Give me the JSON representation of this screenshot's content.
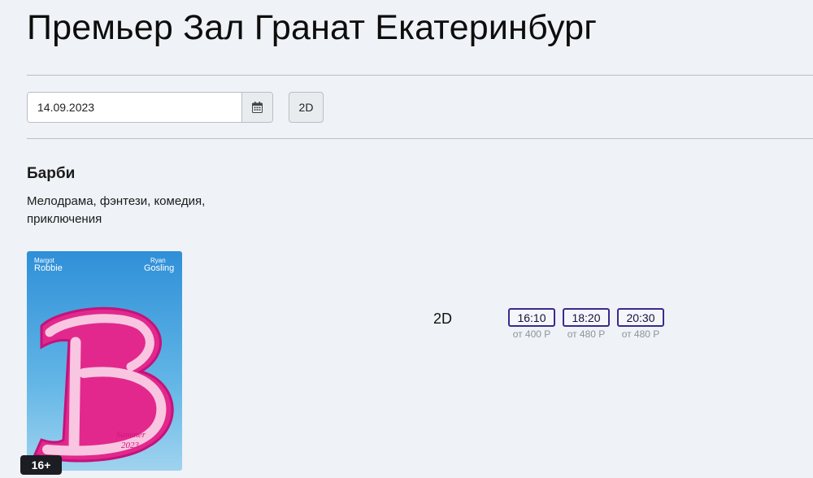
{
  "cinema": {
    "title": "Премьер Зал Гранат Екатеринбург"
  },
  "filters": {
    "date_value": "14.09.2023",
    "calendar_icon": "calendar-icon",
    "format_button_label": "2D"
  },
  "movie": {
    "title": "Барби",
    "genres": "Мелодрама, фэнтези, комедия, приключения",
    "poster": {
      "actor_left_first": "Margot",
      "actor_left_last": "Robbie",
      "actor_right_first": "Ryan",
      "actor_right_last": "Gosling",
      "letter": "B",
      "tagline_line1": "Summer",
      "tagline_line2": "2023",
      "colors": {
        "sky": "#4aa3dc",
        "logo": "#e2288d",
        "logo_inner": "#f8c6e0"
      }
    },
    "age_rating": "16+",
    "schedule": {
      "format": "2D",
      "sessions": [
        {
          "time": "16:10",
          "price": "от 400 Р"
        },
        {
          "time": "18:20",
          "price": "от 480 Р"
        },
        {
          "time": "20:30",
          "price": "от 480 Р"
        }
      ]
    }
  },
  "colors": {
    "session_border": "#3a2a8c",
    "background": "#eff2f6"
  }
}
